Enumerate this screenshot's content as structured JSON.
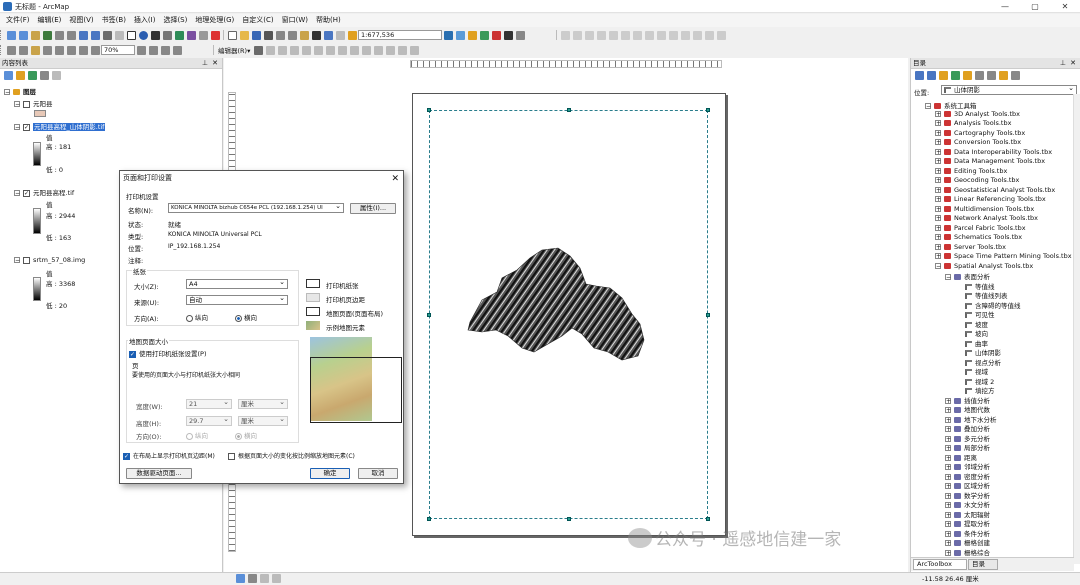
{
  "window": {
    "title": "无标题 - ArcMap",
    "min": "—",
    "max": "▢",
    "close": "✕"
  },
  "menu": [
    "文件(F)",
    "编辑(E)",
    "视图(V)",
    "书签(B)",
    "插入(I)",
    "选择(S)",
    "地理处理(G)",
    "自定义(C)",
    "窗口(W)",
    "帮助(H)"
  ],
  "toolbar": {
    "scale": "1:677,536",
    "zoom": "70%",
    "editor": "编辑器(R)▾"
  },
  "toc": {
    "title": "内容列表",
    "layers_root": "图层",
    "items": [
      {
        "name": "元阳县",
        "checked": false
      },
      {
        "name": "元阳县高程_山体阴影.tif",
        "checked": true,
        "selected": true,
        "value_label": "值",
        "high": "高 : 181",
        "low": "低 : 0"
      },
      {
        "name": "元阳县高程.tif",
        "checked": true,
        "value_label": "值",
        "high": "高 : 2944",
        "low": "低 : 163"
      },
      {
        "name": "srtm_57_08.img",
        "checked": false,
        "value_label": "值",
        "high": "高 : 3368",
        "low": "低 : 20"
      }
    ]
  },
  "dialog": {
    "title": "页面和打印设置",
    "printer_group": "打印机设置",
    "name_label": "名称(N):",
    "name_value": "KONICA MINOLTA bizhub C654e PCL (192.168.1.254) UI",
    "props_btn": "属性(I)...",
    "status_label": "状态:",
    "status_value": "就绪",
    "type_label": "类型:",
    "type_value": "KONICA MINOLTA Universal PCL",
    "where_label": "位置:",
    "where_value": "IP_192.168.1.254",
    "comment_label": "注释:",
    "paper_group": "纸张",
    "size_label": "大小(Z):",
    "size_value": "A4",
    "source_label": "来源(U):",
    "source_value": "自动",
    "orient_label": "方向(A):",
    "portrait": "纵向",
    "landscape": "横向",
    "legend": [
      "打印机纸张",
      "打印机页边距",
      "地图页面(页面布局)",
      "示例地图元素"
    ],
    "mappage_group": "地图页面大小",
    "use_printer": "使用打印机纸张设置(P)",
    "page_group": "页",
    "page_hint": "要使用的页面大小与打印机纸张大小相同",
    "width_label": "宽度(W):",
    "width_value": "21",
    "width_unit": "厘米",
    "height_label": "高度(H):",
    "height_value": "29.7",
    "height_unit": "厘米",
    "orient2_label": "方向(O):",
    "show_margins": "在布局上显示打印机页边距(M)",
    "scale_elements": "根据页面大小的变化按比例缩放地图元素(C)",
    "ddp_btn": "数据驱动页面...",
    "ok": "确定",
    "cancel": "取消"
  },
  "catalog": {
    "title": "目录",
    "location_label": "位置:",
    "location_value": "山体阴影",
    "root": "系统工具箱",
    "toolboxes": [
      "3D Analyst Tools.tbx",
      "Analysis Tools.tbx",
      "Cartography Tools.tbx",
      "Conversion Tools.tbx",
      "Data Interoperability Tools.tbx",
      "Data Management Tools.tbx",
      "Editing Tools.tbx",
      "Geocoding Tools.tbx",
      "Geostatistical Analyst Tools.tbx",
      "Linear Referencing Tools.tbx",
      "Multidimension Tools.tbx",
      "Network Analyst Tools.tbx",
      "Parcel Fabric Tools.tbx",
      "Schematics Tools.tbx",
      "Server Tools.tbx",
      "Space Time Pattern Mining Tools.tbx",
      "Spatial Analyst Tools.tbx"
    ],
    "surface_group": "表面分析",
    "surface_tools": [
      "等值线",
      "等值线列表",
      "含障碍的等值线",
      "可见性",
      "坡度",
      "坡向",
      "曲率",
      "山体阴影",
      "视点分析",
      "视域",
      "视域 2",
      "填挖方"
    ],
    "toolsets": [
      "插值分析",
      "地图代数",
      "地下水分析",
      "叠加分析",
      "多元分析",
      "局部分析",
      "距离",
      "邻域分析",
      "密度分析",
      "区域分析",
      "数学分析",
      "水文分析",
      "太阳辐射",
      "提取分析",
      "条件分析",
      "栅格创建",
      "栅格综合"
    ],
    "tabs": [
      "ArcToolbox",
      "目录"
    ]
  },
  "status": {
    "coords": "-11.58  26.46 厘米"
  },
  "watermark": "公众号 · 遥感地信建一家"
}
